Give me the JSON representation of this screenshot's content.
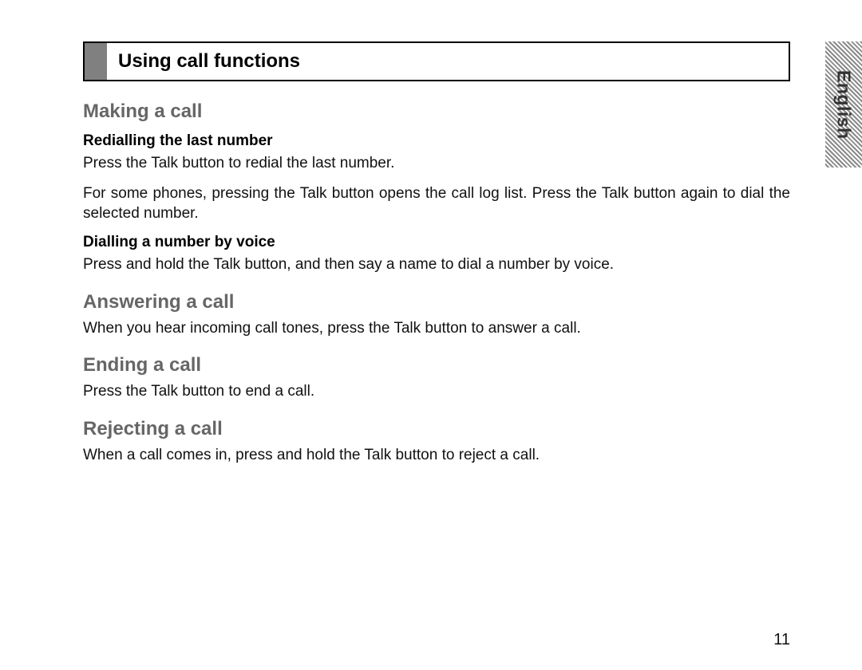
{
  "title": "Using call functions",
  "side_tab": "English",
  "page_number": "11",
  "sections": {
    "making": {
      "heading": "Making a call",
      "sub1_heading": "Redialling the last number",
      "sub1_p1": "Press the Talk button to redial the last number.",
      "sub1_p2": "For some phones, pressing the Talk button opens the call log list. Press the Talk button again to dial the selected number.",
      "sub2_heading": "Dialling a number by voice",
      "sub2_p1": "Press and hold the Talk button, and then say a name to dial a number by voice."
    },
    "answering": {
      "heading": "Answering a call",
      "p1": "When you hear incoming call tones, press the Talk button to answer a call."
    },
    "ending": {
      "heading": "Ending a call",
      "p1": "Press the Talk button to end a call."
    },
    "rejecting": {
      "heading": "Rejecting a call",
      "p1": "When a call comes in, press and hold the Talk button to reject a call."
    }
  }
}
